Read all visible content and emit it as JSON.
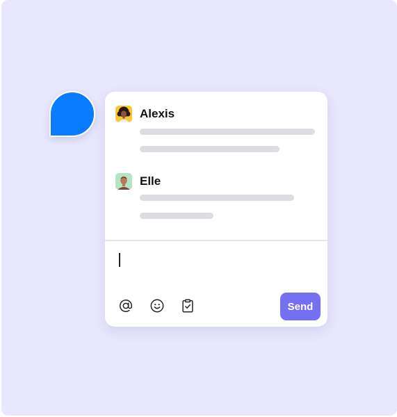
{
  "messages": [
    {
      "author": "Alexis",
      "avatar_icon": "avatar-curly-hair-yellow-bg",
      "avatar_bg": "#f6c83a"
    },
    {
      "author": "Elle",
      "avatar_icon": "avatar-bald-green-bg",
      "avatar_bg": "#b4e3c6"
    }
  ],
  "composer": {
    "send_label": "Send",
    "tools": [
      "mention-icon",
      "emoji-icon",
      "clipboard-check-icon"
    ]
  },
  "colors": {
    "background": "#e8e7fd",
    "launcher": "#0a7cff",
    "send_button": "#7570f2",
    "placeholder_bar": "#dcdde0"
  }
}
